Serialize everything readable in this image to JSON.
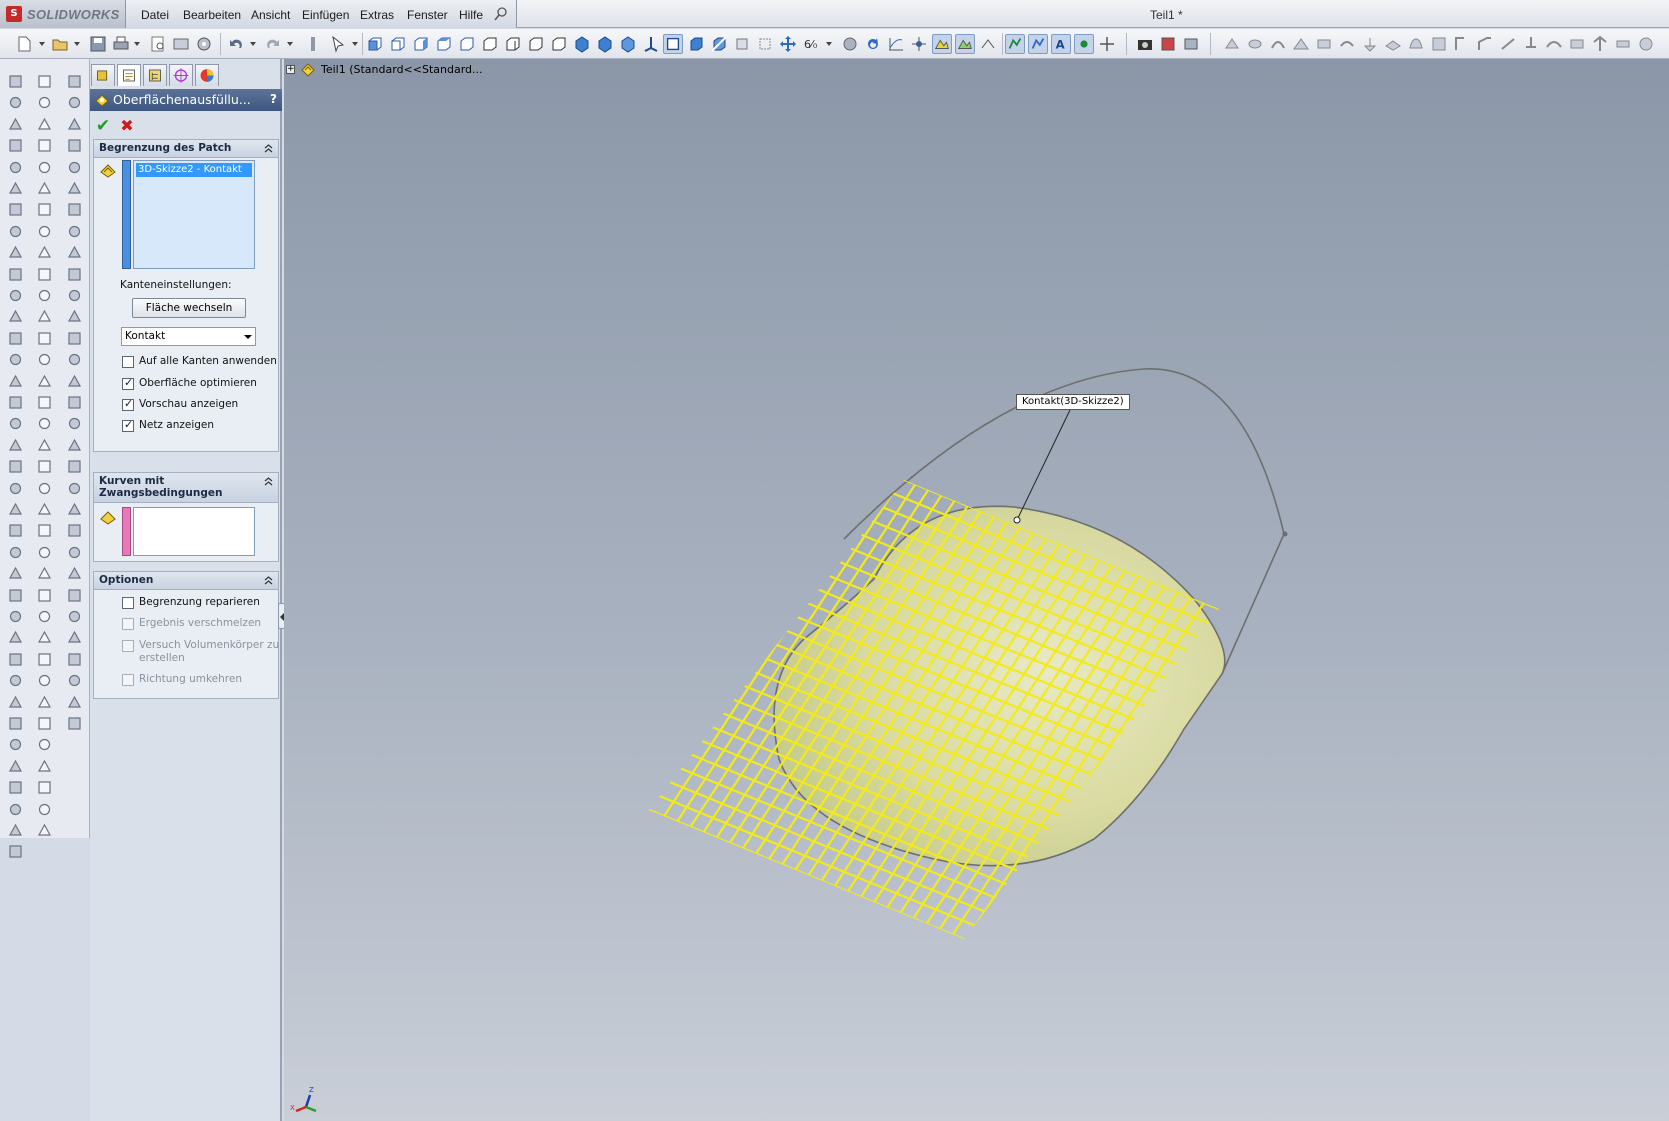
{
  "app": {
    "brand": "SOLIDWORKS",
    "document_title": "Teil1 *"
  },
  "menu": [
    "Datei",
    "Bearbeiten",
    "Ansicht",
    "Einfügen",
    "Extras",
    "Fenster",
    "Hilfe"
  ],
  "property_manager": {
    "title": "Oberflächenausfüllu...",
    "help": "?",
    "tabs": [
      "feature-manager-icon",
      "property-manager-icon",
      "configuration-manager-icon",
      "dimxpert-icon",
      "display-manager-icon"
    ],
    "ok_icon": "checkmark-icon",
    "cancel_icon": "close-icon",
    "groups": {
      "patch_boundary": {
        "title": "Begrenzung des Patch",
        "selected_item": "3D-Skizze2 - Kontakt",
        "edge_settings_label": "Kanteneinstellungen:",
        "alternate_face_button": "Fläche wechseln",
        "condition_value": "Kontakt",
        "checkboxes": [
          {
            "label": "Auf alle Kanten anwenden",
            "checked": false
          },
          {
            "label": "Oberfläche optimieren",
            "checked": true
          },
          {
            "label": "Vorschau anzeigen",
            "checked": true
          },
          {
            "label": "Netz anzeigen",
            "checked": true
          }
        ]
      },
      "constraint_curves": {
        "title_line1": "Kurven mit",
        "title_line2": "Zwangsbedingungen"
      },
      "options": {
        "title": "Optionen",
        "checkboxes": [
          {
            "label": "Begrenzung reparieren",
            "checked": false,
            "enabled": true
          },
          {
            "label": "Ergebnis verschmelzen",
            "checked": false,
            "enabled": false
          },
          {
            "label_line1": "Versuch Volumenkörper zu",
            "label_line2": "erstellen",
            "checked": false,
            "enabled": false
          },
          {
            "label": "Richtung umkehren",
            "checked": false,
            "enabled": false
          }
        ]
      }
    }
  },
  "viewport": {
    "tree_label": "Teil1  (Standard<<Standard...",
    "callout_label": "Kontakt(3D-Skizze2)",
    "triad_axes": {
      "x": "X",
      "y": "Y",
      "z": "Z"
    }
  },
  "colors": {
    "mesh": "#f2ea1c",
    "patch_fill": "#e8e890",
    "boundary": "#6f6f6f",
    "header": "#4a6189",
    "list_selection": "#3399ff",
    "boundary_strip": "#4a90e2",
    "constraint_strip": "#e879b8"
  }
}
